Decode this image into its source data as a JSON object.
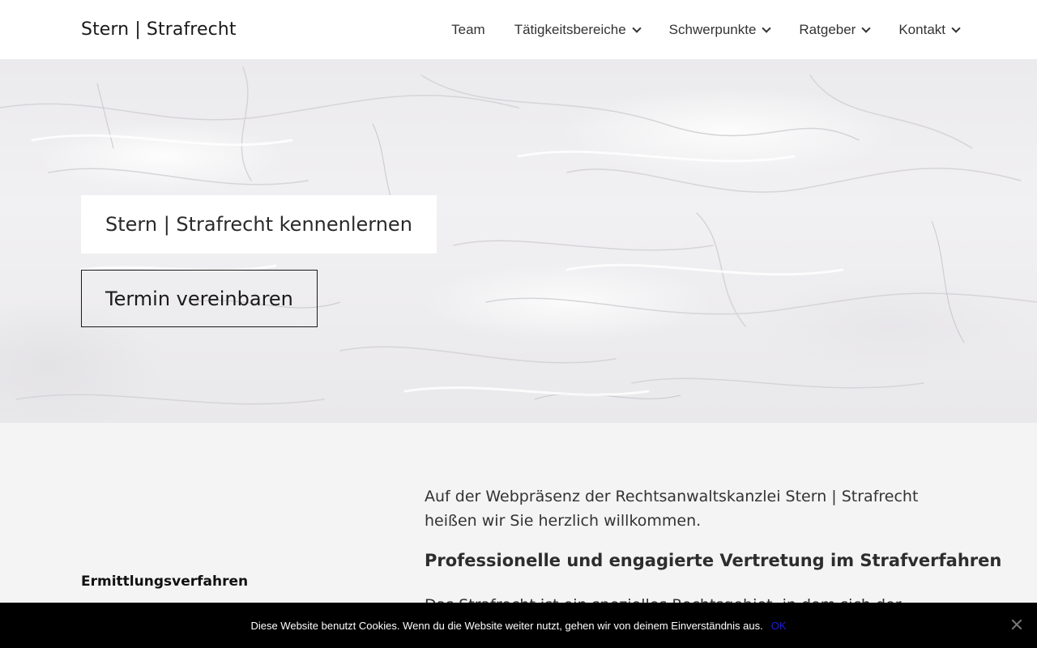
{
  "header": {
    "logo": "Stern | Strafrecht",
    "nav": [
      {
        "label": "Team",
        "has_dropdown": false
      },
      {
        "label": "Tätigkeitsbereiche",
        "has_dropdown": true
      },
      {
        "label": "Schwerpunkte",
        "has_dropdown": true
      },
      {
        "label": "Ratgeber",
        "has_dropdown": true
      },
      {
        "label": "Kontakt",
        "has_dropdown": true
      }
    ]
  },
  "hero": {
    "title": "Stern | Strafrecht kennenlernen",
    "cta_label": "Termin vereinbaren"
  },
  "content": {
    "sidebar_heading": "Ermittlungsverfahren",
    "intro": "Auf der Webpräsenz der Rechtsanwaltskanzlei Stern | Strafrecht heißen wir Sie herzlich willkommen.",
    "section_heading": "Professionelle und engagierte Vertretung im Strafverfahren",
    "body_text": "Das Strafrecht ist ein spezielles Rechtsgebiet, in dem sich der"
  },
  "cookie": {
    "message": "Diese Website benutzt Cookies. Wenn du die Website weiter nutzt, gehen wir von deinem Einverständnis aus.",
    "ok_label": "OK"
  },
  "colors": {
    "header_bg": "#ffffff",
    "page_bg": "#f4f4f4",
    "cookie_bg": "#000000",
    "cookie_ok": "#1a1aff"
  },
  "icons": {
    "dropdown": "chevron-down-icon",
    "cookie_close": "close-icon"
  }
}
